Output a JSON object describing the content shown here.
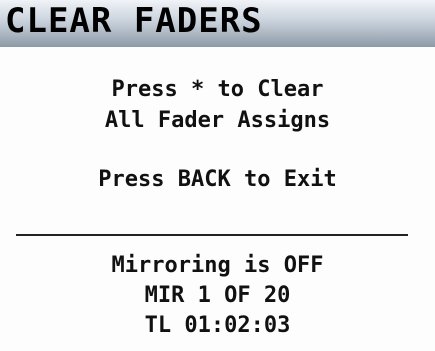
{
  "header": {
    "title": "CLEAR FADERS"
  },
  "message": {
    "line1": "Press * to Clear",
    "line2": "All Fader Assigns",
    "line3": "Press BACK to Exit"
  },
  "status": {
    "mirroring": "Mirroring is OFF",
    "mir": "MIR 1 OF 20",
    "timecode": "TL 01:02:03"
  }
}
